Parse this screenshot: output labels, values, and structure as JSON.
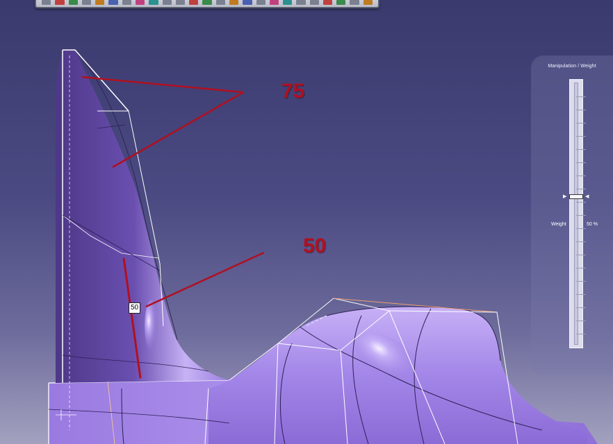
{
  "toolbar": {
    "icons": [
      "toolbar-icon-1",
      "toolbar-icon-2",
      "toolbar-icon-3",
      "toolbar-icon-4",
      "toolbar-icon-5",
      "toolbar-icon-6",
      "toolbar-icon-7",
      "toolbar-icon-8",
      "toolbar-icon-9",
      "toolbar-icon-10",
      "toolbar-icon-11",
      "toolbar-icon-12",
      "toolbar-icon-13",
      "toolbar-icon-14",
      "toolbar-icon-15",
      "toolbar-icon-16",
      "toolbar-icon-17",
      "toolbar-icon-18",
      "toolbar-icon-19",
      "toolbar-icon-20",
      "toolbar-icon-21",
      "toolbar-icon-22",
      "toolbar-icon-23",
      "toolbar-icon-24",
      "toolbar-icon-25"
    ]
  },
  "panel": {
    "title": "Manipulation / Weight",
    "weight_label": "Weight",
    "weight_value": "50 %",
    "weight_fraction": 0.5,
    "handle_left_arrow": "▶",
    "handle_right_arrow": "◀"
  },
  "annotations": {
    "upper": "75",
    "lower": "50",
    "surface_tag": "50"
  },
  "colors": {
    "surface": "#a98be8",
    "annotation": "#b01020",
    "background_top": "#3a3a6e"
  }
}
